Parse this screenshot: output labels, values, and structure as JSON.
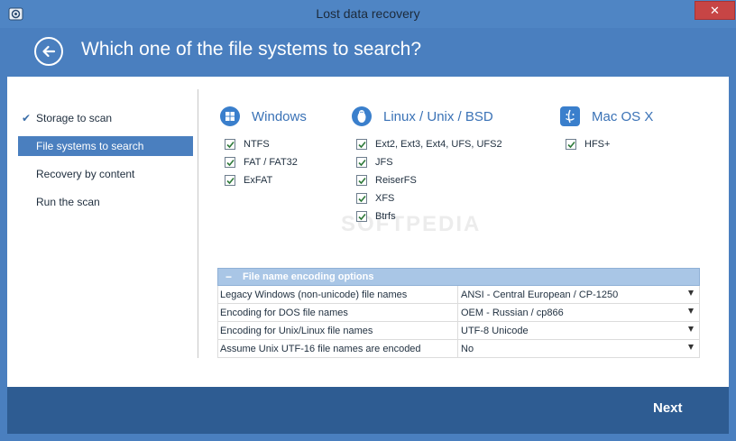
{
  "window": {
    "title": "Lost data recovery",
    "close_glyph": "✕"
  },
  "header": {
    "title": "Which one of the file systems to search?"
  },
  "nav": {
    "items": [
      {
        "label": "Storage to scan",
        "checked": true,
        "selected": false
      },
      {
        "label": "File systems to search",
        "checked": false,
        "selected": true
      },
      {
        "label": "Recovery by content",
        "checked": false,
        "selected": false
      },
      {
        "label": "Run the scan",
        "checked": false,
        "selected": false
      }
    ]
  },
  "filesystems": {
    "windows": {
      "title": "Windows",
      "icon": "windows-logo-icon",
      "items": [
        "NTFS",
        "FAT / FAT32",
        "ExFAT"
      ]
    },
    "linux": {
      "title": "Linux / Unix / BSD",
      "icon": "tux-penguin-icon",
      "items": [
        "Ext2, Ext3, Ext4, UFS, UFS2",
        "JFS",
        "ReiserFS",
        "XFS",
        "Btrfs"
      ]
    },
    "mac": {
      "title": "Mac OS X",
      "icon": "mac-finder-icon",
      "items": [
        "HFS+"
      ]
    }
  },
  "encoding": {
    "collapse_glyph": "−",
    "title": "File name encoding options",
    "rows": [
      {
        "label": "Legacy Windows (non-unicode) file names",
        "value": "ANSI - Central European / CP-1250"
      },
      {
        "label": "Encoding for DOS file names",
        "value": "OEM - Russian / cp866"
      },
      {
        "label": "Encoding for Unix/Linux file names",
        "value": "UTF-8 Unicode"
      },
      {
        "label": "Assume Unix UTF-16 file names are encoded",
        "value": "No"
      }
    ]
  },
  "footer": {
    "next_label": "Next"
  },
  "watermark": "SOFTPEDIA",
  "colors": {
    "accent": "#4a7fbf",
    "footer": "#2e5c92",
    "close": "#c74545",
    "link": "#3a72b6"
  }
}
